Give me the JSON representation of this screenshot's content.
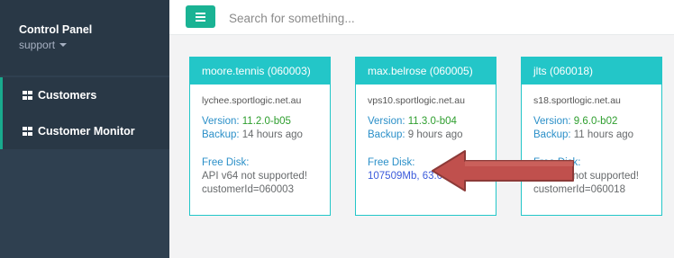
{
  "sidebar": {
    "profile": {
      "title": "Control Panel",
      "user": "support"
    },
    "items": [
      {
        "label": "Customers",
        "icon": "grid-icon"
      },
      {
        "label": "Customer Monitor",
        "icon": "grid-icon"
      }
    ]
  },
  "topbar": {
    "search_placeholder": "Search for something..."
  },
  "cards": [
    {
      "title": "moore.tennis (060003)",
      "host": "lychee.sportlogic.net.au",
      "version_label": "Version:",
      "version": "11.2.0-b05",
      "backup_label": "Backup:",
      "backup": "14 hours ago",
      "freedisk_label": "Free Disk:",
      "disk_line1": "API v64 not supported!",
      "disk_line2": "customerId=060003"
    },
    {
      "title": "max.belrose (060005)",
      "host": "vps10.sportlogic.net.au",
      "version_label": "Version:",
      "version": "11.3.0-b04",
      "backup_label": "Backup:",
      "backup": "9 hours ago",
      "freedisk_label": "Free Disk:",
      "disk_line1": "107509Mb, 63.0%"
    },
    {
      "title": "jlts (060018)",
      "host": "s18.sportlogic.net.au",
      "version_label": "Version:",
      "version": "9.6.0-b02",
      "backup_label": "Backup:",
      "backup": "11 hours ago",
      "freedisk_label": "Free Disk:",
      "disk_line1": "API v55 not supported!",
      "disk_line2": "customerId=060018"
    }
  ],
  "colors": {
    "sidebar_bg": "#2f4050",
    "accent": "#1ab394",
    "card_header": "#23c6c8",
    "arrow": "#c0504d"
  }
}
